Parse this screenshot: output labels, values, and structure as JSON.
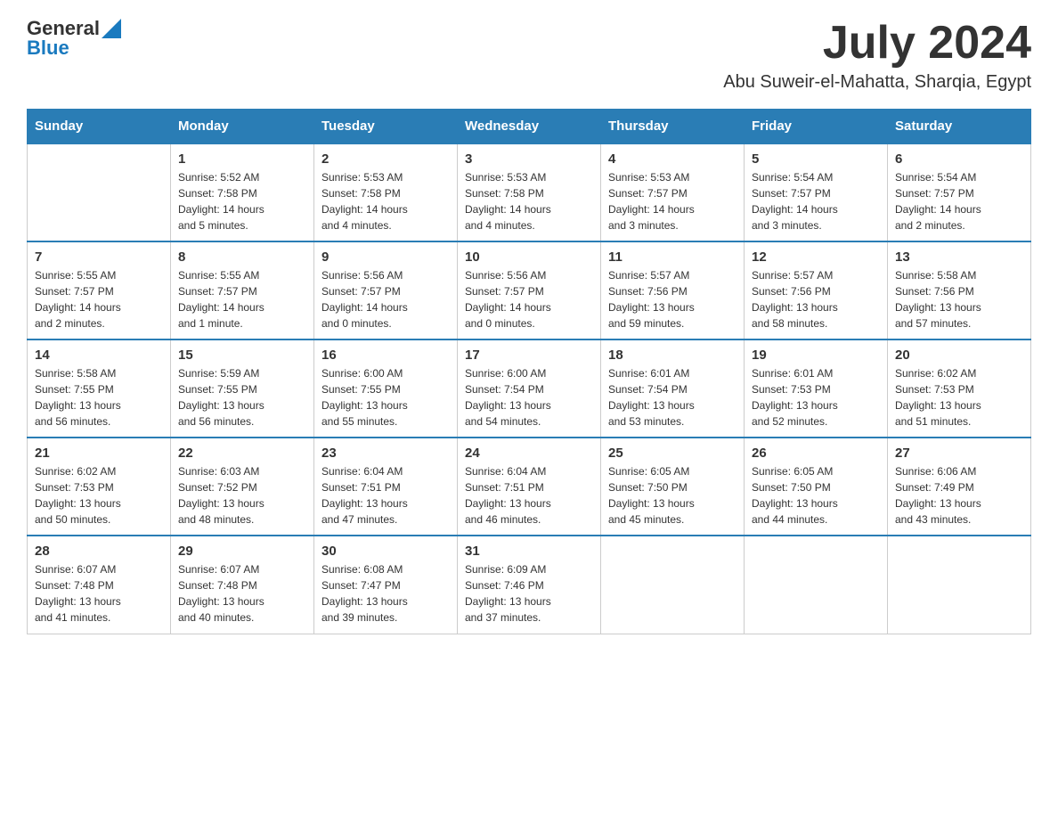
{
  "header": {
    "logo_general": "General",
    "logo_blue": "Blue",
    "month_year": "July 2024",
    "location": "Abu Suweir-el-Mahatta, Sharqia, Egypt"
  },
  "days_of_week": [
    "Sunday",
    "Monday",
    "Tuesday",
    "Wednesday",
    "Thursday",
    "Friday",
    "Saturday"
  ],
  "weeks": [
    [
      {
        "day": "",
        "info": ""
      },
      {
        "day": "1",
        "info": "Sunrise: 5:52 AM\nSunset: 7:58 PM\nDaylight: 14 hours\nand 5 minutes."
      },
      {
        "day": "2",
        "info": "Sunrise: 5:53 AM\nSunset: 7:58 PM\nDaylight: 14 hours\nand 4 minutes."
      },
      {
        "day": "3",
        "info": "Sunrise: 5:53 AM\nSunset: 7:58 PM\nDaylight: 14 hours\nand 4 minutes."
      },
      {
        "day": "4",
        "info": "Sunrise: 5:53 AM\nSunset: 7:57 PM\nDaylight: 14 hours\nand 3 minutes."
      },
      {
        "day": "5",
        "info": "Sunrise: 5:54 AM\nSunset: 7:57 PM\nDaylight: 14 hours\nand 3 minutes."
      },
      {
        "day": "6",
        "info": "Sunrise: 5:54 AM\nSunset: 7:57 PM\nDaylight: 14 hours\nand 2 minutes."
      }
    ],
    [
      {
        "day": "7",
        "info": "Sunrise: 5:55 AM\nSunset: 7:57 PM\nDaylight: 14 hours\nand 2 minutes."
      },
      {
        "day": "8",
        "info": "Sunrise: 5:55 AM\nSunset: 7:57 PM\nDaylight: 14 hours\nand 1 minute."
      },
      {
        "day": "9",
        "info": "Sunrise: 5:56 AM\nSunset: 7:57 PM\nDaylight: 14 hours\nand 0 minutes."
      },
      {
        "day": "10",
        "info": "Sunrise: 5:56 AM\nSunset: 7:57 PM\nDaylight: 14 hours\nand 0 minutes."
      },
      {
        "day": "11",
        "info": "Sunrise: 5:57 AM\nSunset: 7:56 PM\nDaylight: 13 hours\nand 59 minutes."
      },
      {
        "day": "12",
        "info": "Sunrise: 5:57 AM\nSunset: 7:56 PM\nDaylight: 13 hours\nand 58 minutes."
      },
      {
        "day": "13",
        "info": "Sunrise: 5:58 AM\nSunset: 7:56 PM\nDaylight: 13 hours\nand 57 minutes."
      }
    ],
    [
      {
        "day": "14",
        "info": "Sunrise: 5:58 AM\nSunset: 7:55 PM\nDaylight: 13 hours\nand 56 minutes."
      },
      {
        "day": "15",
        "info": "Sunrise: 5:59 AM\nSunset: 7:55 PM\nDaylight: 13 hours\nand 56 minutes."
      },
      {
        "day": "16",
        "info": "Sunrise: 6:00 AM\nSunset: 7:55 PM\nDaylight: 13 hours\nand 55 minutes."
      },
      {
        "day": "17",
        "info": "Sunrise: 6:00 AM\nSunset: 7:54 PM\nDaylight: 13 hours\nand 54 minutes."
      },
      {
        "day": "18",
        "info": "Sunrise: 6:01 AM\nSunset: 7:54 PM\nDaylight: 13 hours\nand 53 minutes."
      },
      {
        "day": "19",
        "info": "Sunrise: 6:01 AM\nSunset: 7:53 PM\nDaylight: 13 hours\nand 52 minutes."
      },
      {
        "day": "20",
        "info": "Sunrise: 6:02 AM\nSunset: 7:53 PM\nDaylight: 13 hours\nand 51 minutes."
      }
    ],
    [
      {
        "day": "21",
        "info": "Sunrise: 6:02 AM\nSunset: 7:53 PM\nDaylight: 13 hours\nand 50 minutes."
      },
      {
        "day": "22",
        "info": "Sunrise: 6:03 AM\nSunset: 7:52 PM\nDaylight: 13 hours\nand 48 minutes."
      },
      {
        "day": "23",
        "info": "Sunrise: 6:04 AM\nSunset: 7:51 PM\nDaylight: 13 hours\nand 47 minutes."
      },
      {
        "day": "24",
        "info": "Sunrise: 6:04 AM\nSunset: 7:51 PM\nDaylight: 13 hours\nand 46 minutes."
      },
      {
        "day": "25",
        "info": "Sunrise: 6:05 AM\nSunset: 7:50 PM\nDaylight: 13 hours\nand 45 minutes."
      },
      {
        "day": "26",
        "info": "Sunrise: 6:05 AM\nSunset: 7:50 PM\nDaylight: 13 hours\nand 44 minutes."
      },
      {
        "day": "27",
        "info": "Sunrise: 6:06 AM\nSunset: 7:49 PM\nDaylight: 13 hours\nand 43 minutes."
      }
    ],
    [
      {
        "day": "28",
        "info": "Sunrise: 6:07 AM\nSunset: 7:48 PM\nDaylight: 13 hours\nand 41 minutes."
      },
      {
        "day": "29",
        "info": "Sunrise: 6:07 AM\nSunset: 7:48 PM\nDaylight: 13 hours\nand 40 minutes."
      },
      {
        "day": "30",
        "info": "Sunrise: 6:08 AM\nSunset: 7:47 PM\nDaylight: 13 hours\nand 39 minutes."
      },
      {
        "day": "31",
        "info": "Sunrise: 6:09 AM\nSunset: 7:46 PM\nDaylight: 13 hours\nand 37 minutes."
      },
      {
        "day": "",
        "info": ""
      },
      {
        "day": "",
        "info": ""
      },
      {
        "day": "",
        "info": ""
      }
    ]
  ]
}
